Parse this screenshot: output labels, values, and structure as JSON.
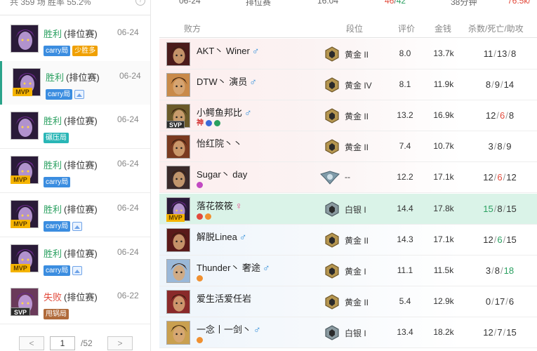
{
  "left": {
    "stats": "共 359 场   胜率 55.2%",
    "help_icon": "?",
    "matches": [
      {
        "result": "胜利",
        "lose": false,
        "mode": "(排位赛)",
        "date": "06-24",
        "badge": "",
        "tags": [
          {
            "text": "carry局",
            "color": "blue"
          },
          {
            "text": "少胜多",
            "color": "orange"
          }
        ],
        "image_icon": false
      },
      {
        "result": "胜利",
        "lose": false,
        "mode": "(排位赛)",
        "date": "06-24",
        "badge": "MVP",
        "tags": [
          {
            "text": "carry局",
            "color": "blue"
          }
        ],
        "image_icon": true
      },
      {
        "result": "胜利",
        "lose": false,
        "mode": "(排位赛)",
        "date": "06-24",
        "badge": "",
        "tags": [
          {
            "text": "碾压局",
            "color": "teal"
          }
        ],
        "image_icon": false
      },
      {
        "result": "胜利",
        "lose": false,
        "mode": "(排位赛)",
        "date": "06-24",
        "badge": "MVP",
        "tags": [
          {
            "text": "carry局",
            "color": "blue"
          }
        ],
        "image_icon": false
      },
      {
        "result": "胜利",
        "lose": false,
        "mode": "(排位赛)",
        "date": "06-24",
        "badge": "MVP",
        "tags": [
          {
            "text": "carry局",
            "color": "blue"
          }
        ],
        "image_icon": true
      },
      {
        "result": "胜利",
        "lose": false,
        "mode": "(排位赛)",
        "date": "06-24",
        "badge": "MVP",
        "tags": [
          {
            "text": "carry局",
            "color": "blue"
          }
        ],
        "image_icon": true
      },
      {
        "result": "失败",
        "lose": true,
        "mode": "(排位赛)",
        "date": "06-22",
        "badge": "SVP",
        "tags": [
          {
            "text": "甩锅局",
            "color": "brown"
          }
        ],
        "image_icon": false
      }
    ],
    "pager": {
      "prev": "<",
      "page": "1",
      "total": "/52",
      "next": ">"
    }
  },
  "summary": {
    "date": "06-24",
    "mode": "排位赛",
    "time": "16:04",
    "score_red": "46",
    "score_sep": "/",
    "score_green": "42",
    "duration": "38分钟",
    "gold_total": "76.5k/"
  },
  "table": {
    "headers": {
      "team": "败方",
      "rank": "段位",
      "score": "评价",
      "gold": "金钱",
      "kda": "杀数/死亡/助攻"
    },
    "rows": [
      {
        "name": "AKT丶 Winer",
        "sex": "male",
        "rank_tier": "gold",
        "rank": "黄金 II",
        "score": "8.0",
        "gold": "13.7k",
        "k": "11",
        "d": "13",
        "a": "8",
        "k_c": "",
        "d_c": "",
        "a_c": "",
        "badge": "",
        "marks": [],
        "team": "lose",
        "avatar": "#4a1a1a",
        "gold_c": "",
        "score_c": ""
      },
      {
        "name": "DTW丶 演员",
        "sex": "male",
        "rank_tier": "gold",
        "rank": "黄金 IV",
        "score": "8.1",
        "gold": "11.9k",
        "k": "8",
        "d": "9",
        "a": "14",
        "k_c": "",
        "d_c": "",
        "a_c": "",
        "badge": "",
        "marks": [],
        "team": "lose",
        "avatar": "#c98a4a",
        "gold_c": "",
        "score_c": ""
      },
      {
        "name": "小鳄鱼邦比",
        "sex": "male",
        "rank_tier": "gold",
        "rank": "黄金 II",
        "score": "13.2",
        "gold": "16.9k",
        "k": "12",
        "d": "6",
        "a": "8",
        "k_c": "",
        "d_c": "red",
        "a_c": "",
        "badge": "SVP",
        "marks": [
          "神",
          "wb",
          "wg"
        ],
        "team": "lose",
        "avatar": "#6b5a2a",
        "gold_c": "",
        "score_c": ""
      },
      {
        "name": "怡红院丶丶",
        "sex": "",
        "rank_tier": "gold",
        "rank": "黄金 II",
        "score": "7.4",
        "gold": "10.7k",
        "k": "3",
        "d": "8",
        "a": "9",
        "k_c": "",
        "d_c": "",
        "a_c": "",
        "badge": "",
        "marks": [],
        "team": "lose",
        "avatar": "#7a3a20",
        "gold_c": "",
        "score_c": ""
      },
      {
        "name": "Sugar丶 day",
        "sex": "",
        "rank_tier": "unranked",
        "rank": "--",
        "score": "12.2",
        "gold": "17.1k",
        "k": "12",
        "d": "6",
        "a": "12",
        "k_c": "",
        "d_c": "red",
        "a_c": "",
        "badge": "",
        "marks": [
          "wp"
        ],
        "team": "lose",
        "avatar": "#3a2a2a",
        "gold_c": "",
        "score_c": ""
      },
      {
        "name": "落花筱筱",
        "sex": "female",
        "rank_tier": "silver",
        "rank": "白银 I",
        "score": "14.4",
        "gold": "17.8k",
        "k": "15",
        "d": "8",
        "a": "15",
        "k_c": "green",
        "d_c": "",
        "a_c": "",
        "badge": "MVP",
        "marks": [
          "wr",
          "wo"
        ],
        "team": "self",
        "avatar": "#2a1b38",
        "gold_c": "",
        "score_c": "green"
      },
      {
        "name": "解脱Linea",
        "sex": "male",
        "rank_tier": "gold",
        "rank": "黄金 II",
        "score": "14.3",
        "gold": "17.1k",
        "k": "12",
        "d": "6",
        "a": "15",
        "k_c": "",
        "d_c": "green",
        "a_c": "",
        "badge": "",
        "marks": [],
        "team": "win",
        "avatar": "#5a1a1a",
        "gold_c": "",
        "score_c": ""
      },
      {
        "name": "Thunder丶 奢途",
        "sex": "male",
        "rank_tier": "gold",
        "rank": "黄金 I",
        "score": "11.1",
        "gold": "11.5k",
        "k": "3",
        "d": "8",
        "a": "18",
        "k_c": "",
        "d_c": "",
        "a_c": "green",
        "badge": "",
        "marks": [
          "wo"
        ],
        "team": "win",
        "avatar": "#9ab8d8",
        "gold_c": "",
        "score_c": ""
      },
      {
        "name": "爱生活爱任岩",
        "sex": "",
        "rank_tier": "gold",
        "rank": "黄金 II",
        "score": "5.4",
        "gold": "12.9k",
        "k": "0",
        "d": "17",
        "a": "6",
        "k_c": "",
        "d_c": "",
        "a_c": "",
        "badge": "",
        "marks": [],
        "team": "win",
        "avatar": "#8a2a2a",
        "gold_c": "",
        "score_c": ""
      },
      {
        "name": "一念丨一剑丶",
        "sex": "male",
        "rank_tier": "silver",
        "rank": "白银 I",
        "score": "13.4",
        "gold": "18.2k",
        "k": "12",
        "d": "7",
        "a": "15",
        "k_c": "",
        "d_c": "",
        "a_c": "",
        "badge": "",
        "marks": [
          "wo"
        ],
        "team": "win",
        "avatar": "#c9a050",
        "gold_c": "green",
        "score_c": ""
      }
    ]
  },
  "colors": {
    "win": "#2aa060",
    "lose": "#e24a3b",
    "male": "#2b8bd8",
    "female": "#e84a8a",
    "self_row": "#daf3e8"
  }
}
